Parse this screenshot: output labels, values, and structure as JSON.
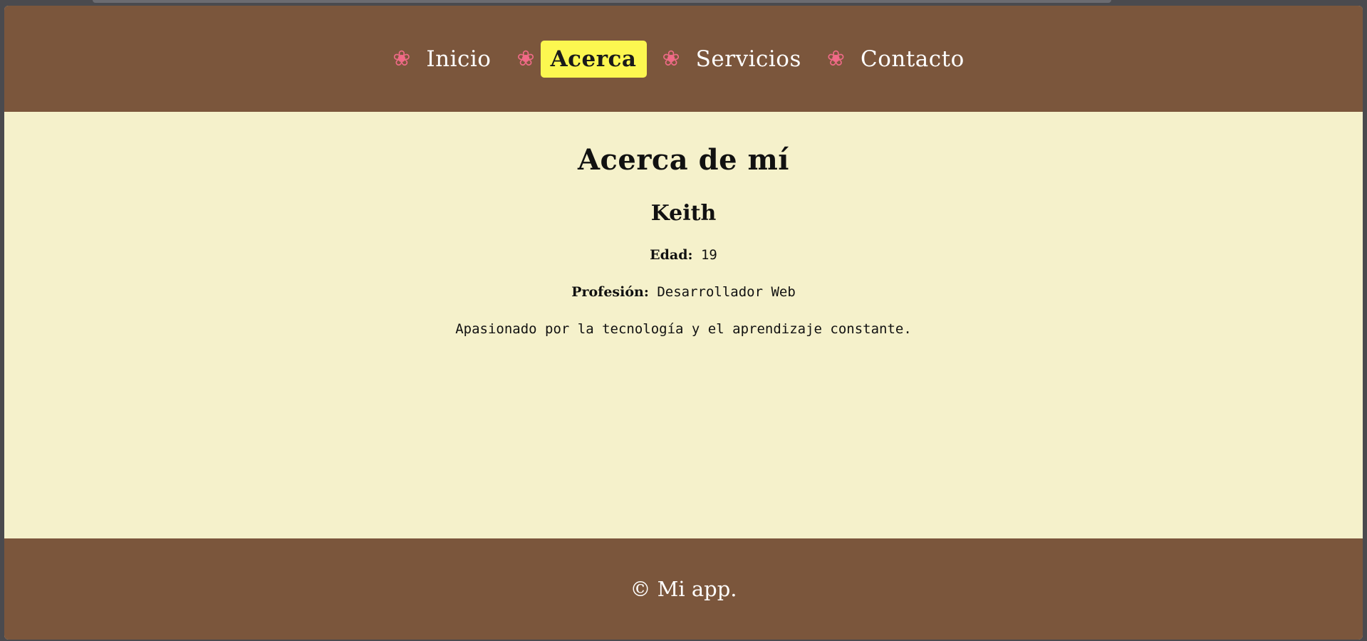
{
  "nav": {
    "items": [
      {
        "icon": "❀",
        "label": "Inicio",
        "active": false
      },
      {
        "icon": "❀",
        "label": "Acerca",
        "active": true
      },
      {
        "icon": "❀",
        "label": "Servicios",
        "active": false
      },
      {
        "icon": "❀",
        "label": "Contacto",
        "active": false
      }
    ]
  },
  "main": {
    "title": "Acerca de mí",
    "name": "Keith",
    "age_label": "Edad:",
    "age_value": "19",
    "profession_label": "Profesión:",
    "profession_value": "Desarrollador Web",
    "bio": "Apasionado por la tecnología y el aprendizaje constante."
  },
  "footer": {
    "text": "© Mi app."
  },
  "colors": {
    "header_bg": "#7b563c",
    "content_bg": "#f5f1cb",
    "active_bg": "#fcf750",
    "flower": "#f06a87"
  }
}
